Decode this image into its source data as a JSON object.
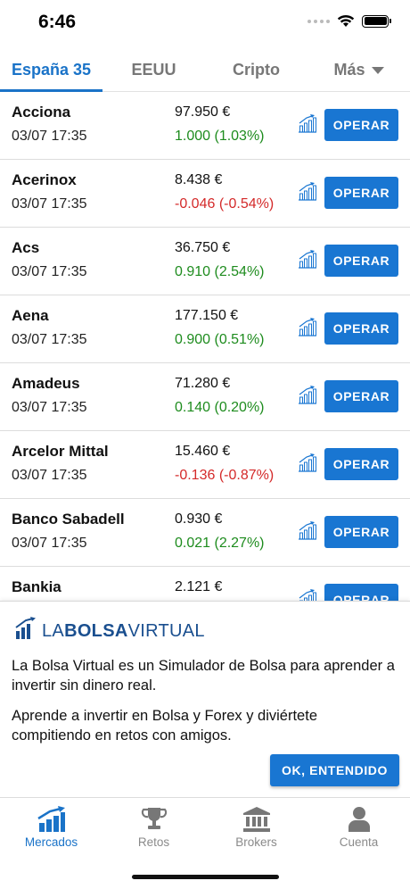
{
  "status_bar": {
    "time": "6:46"
  },
  "tabs": [
    {
      "label": "España 35",
      "active": true
    },
    {
      "label": "EEUU",
      "active": false
    },
    {
      "label": "Cripto",
      "active": false
    },
    {
      "label": "Más",
      "active": false
    }
  ],
  "stocks": [
    {
      "name": "Acciona",
      "date": "03/07 17:35",
      "price": "97.950 €",
      "change": "1.000 (1.03%)",
      "direction": "up"
    },
    {
      "name": "Acerinox",
      "date": "03/07 17:35",
      "price": "8.438 €",
      "change": "-0.046 (-0.54%)",
      "direction": "down"
    },
    {
      "name": "Acs",
      "date": "03/07 17:35",
      "price": "36.750 €",
      "change": "0.910 (2.54%)",
      "direction": "up"
    },
    {
      "name": "Aena",
      "date": "03/07 17:35",
      "price": "177.150 €",
      "change": "0.900 (0.51%)",
      "direction": "up"
    },
    {
      "name": "Amadeus",
      "date": "03/07 17:35",
      "price": "71.280 €",
      "change": "0.140 (0.20%)",
      "direction": "up"
    },
    {
      "name": "Arcelor Mittal",
      "date": "03/07 17:35",
      "price": "15.460 €",
      "change": "-0.136 (-0.87%)",
      "direction": "down"
    },
    {
      "name": "Banco Sabadell",
      "date": "03/07 17:35",
      "price": "0.930 €",
      "change": "0.021 (2.27%)",
      "direction": "up"
    },
    {
      "name": "Bankia",
      "date": "",
      "price": "2.121 €",
      "change": "",
      "direction": "up"
    }
  ],
  "operar_label": "OPERAR",
  "info_panel": {
    "logo_part1": "LA",
    "logo_part2": "BOLSA",
    "logo_part3": "VIRTUAL",
    "paragraph1": "La Bolsa Virtual es un Simulador de Bolsa para aprender a invertir sin dinero real.",
    "paragraph2": "Aprende a invertir en Bolsa y Forex y diviértete compitiendo en retos con amigos.",
    "ok_label": "OK, ENTENDIDO"
  },
  "bottom_nav": [
    {
      "label": "Mercados",
      "icon": "market-chart-icon",
      "active": true
    },
    {
      "label": "Retos",
      "icon": "trophy-icon",
      "active": false
    },
    {
      "label": "Brokers",
      "icon": "bank-icon",
      "active": false
    },
    {
      "label": "Cuenta",
      "icon": "user-icon",
      "active": false
    }
  ],
  "colors": {
    "accent": "#1976d2",
    "positive": "#1e8c1e",
    "negative": "#d42a2a",
    "inactive": "#8a8a8a"
  }
}
